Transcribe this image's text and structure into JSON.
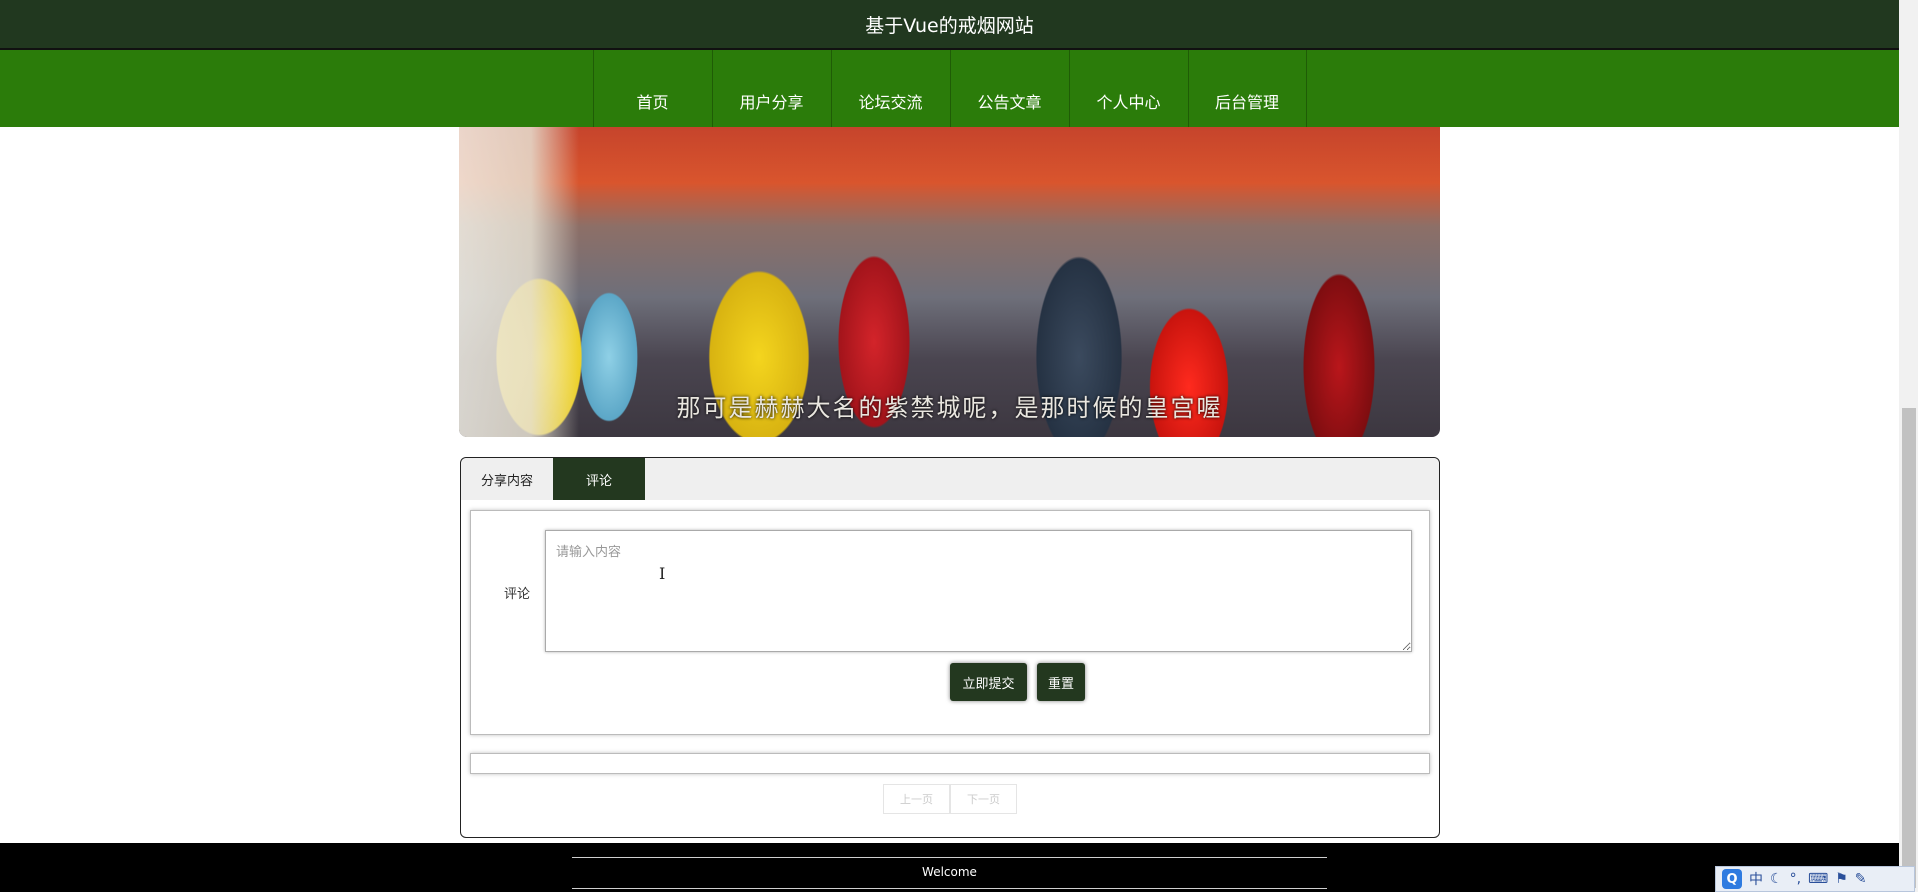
{
  "header": {
    "site_title": "基于Vue的戒烟网站"
  },
  "nav": {
    "items": [
      {
        "label": "首页"
      },
      {
        "label": "用户分享"
      },
      {
        "label": "论坛交流"
      },
      {
        "label": "公告文章"
      },
      {
        "label": "个人中心"
      },
      {
        "label": "后台管理"
      }
    ]
  },
  "banner": {
    "caption": "那可是赫赫大名的紫禁城呢，是那时候的皇宫喔"
  },
  "tabs": [
    {
      "label": "分享内容",
      "active": false
    },
    {
      "label": "评论",
      "active": true
    }
  ],
  "comment_form": {
    "label": "评论",
    "placeholder": "请输入内容",
    "submit_label": "立即提交",
    "reset_label": "重置"
  },
  "pager": {
    "prev_label": "上一页",
    "next_label": "下一页"
  },
  "footer": {
    "text": "Welcome"
  },
  "ime": {
    "logo": "Q",
    "mode": "中",
    "icons": [
      "moon-icon",
      "punctuation-icon",
      "keyboard-icon",
      "tools-icon",
      "wrench-icon"
    ]
  },
  "colors": {
    "topbar": "#21381f",
    "nav": "#2b7c0a",
    "accent_dark": "#23381f",
    "footer": "#000000"
  }
}
